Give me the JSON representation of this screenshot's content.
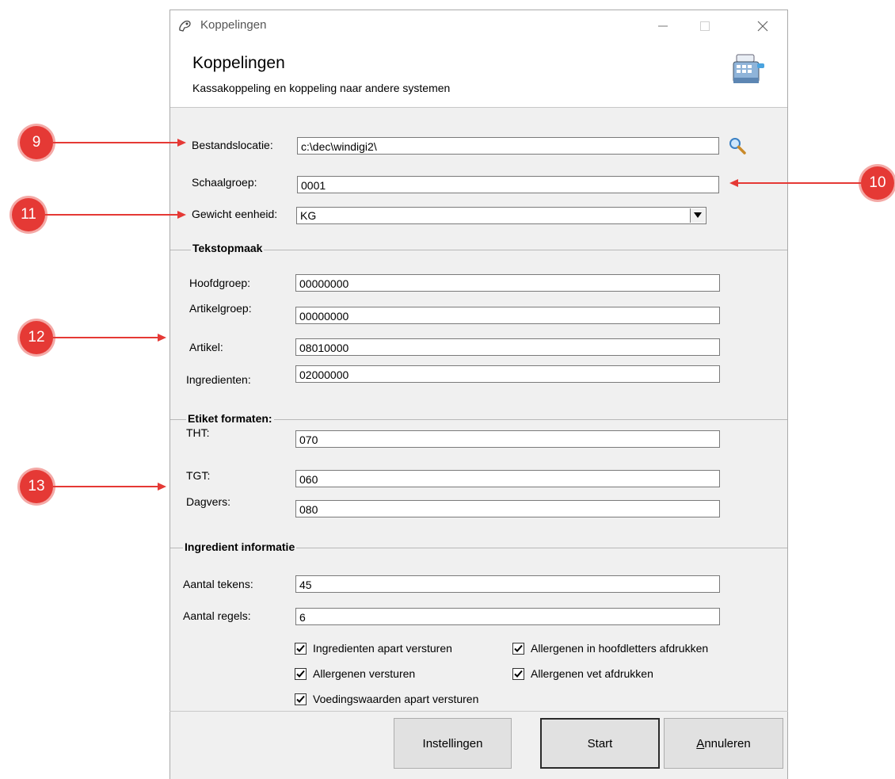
{
  "window": {
    "title": "Koppelingen",
    "header_title": "Koppelingen",
    "header_subtitle": "Kassakoppeling en koppeling naar andere systemen"
  },
  "fields": {
    "bestandslocatie": {
      "label": "Bestandslocatie:",
      "value": "c:\\dec\\windigi2\\"
    },
    "schaalgroep": {
      "label": "Schaalgroep:",
      "value": "0001"
    },
    "gewicht": {
      "label": "Gewicht eenheid:",
      "value": "KG"
    }
  },
  "tekstopmaak": {
    "title": "Tekstopmaak",
    "hoofdgroep": {
      "label": "Hoofdgroep:",
      "value": "00000000"
    },
    "artikelgroep": {
      "label": "Artikelgroep:",
      "value": "00000000"
    },
    "artikel": {
      "label": "Artikel:",
      "value": "08010000"
    },
    "ingredienten": {
      "label": "Ingredienten:",
      "value": "02000000"
    }
  },
  "etiket": {
    "title": "Etiket formaten:",
    "tht": {
      "label": "THT:",
      "value": "070"
    },
    "tgt": {
      "label": "TGT:",
      "value": "060"
    },
    "dagvers": {
      "label": "Dagvers:",
      "value": "080"
    }
  },
  "ingredient_info": {
    "title": "Ingredient informatie",
    "aantal_tekens": {
      "label": "Aantal tekens:",
      "value": "45"
    },
    "aantal_regels": {
      "label": "Aantal regels:",
      "value": "6"
    }
  },
  "checkboxes": {
    "ingredienten_apart": {
      "label": "Ingredienten apart versturen",
      "checked": true
    },
    "allergenen_versturen": {
      "label": "Allergenen versturen",
      "checked": true
    },
    "voedingswaarden_apart": {
      "label": "Voedingswaarden apart versturen",
      "checked": true
    },
    "allergenen_hoofdletters": {
      "label": "Allergenen in hoofdletters afdrukken",
      "checked": true
    },
    "allergenen_vet": {
      "label": "Allergenen vet afdrukken",
      "checked": true
    }
  },
  "buttons": {
    "instellingen": "Instellingen",
    "start": "Start",
    "annuleren_underlined": "A",
    "annuleren_rest": "nnuleren"
  },
  "callouts": {
    "c9": "9",
    "c10": "10",
    "c11": "11",
    "c12": "12",
    "c13": "13"
  },
  "icons": [
    "app-icon",
    "minimize-icon",
    "maximize-icon",
    "close-icon",
    "cash-register-icon",
    "search-icon",
    "dropdown-arrow-icon",
    "checkmark-icon"
  ],
  "colors": {
    "callout": "#e53935",
    "dialog_bg": "#f0f0f0"
  }
}
